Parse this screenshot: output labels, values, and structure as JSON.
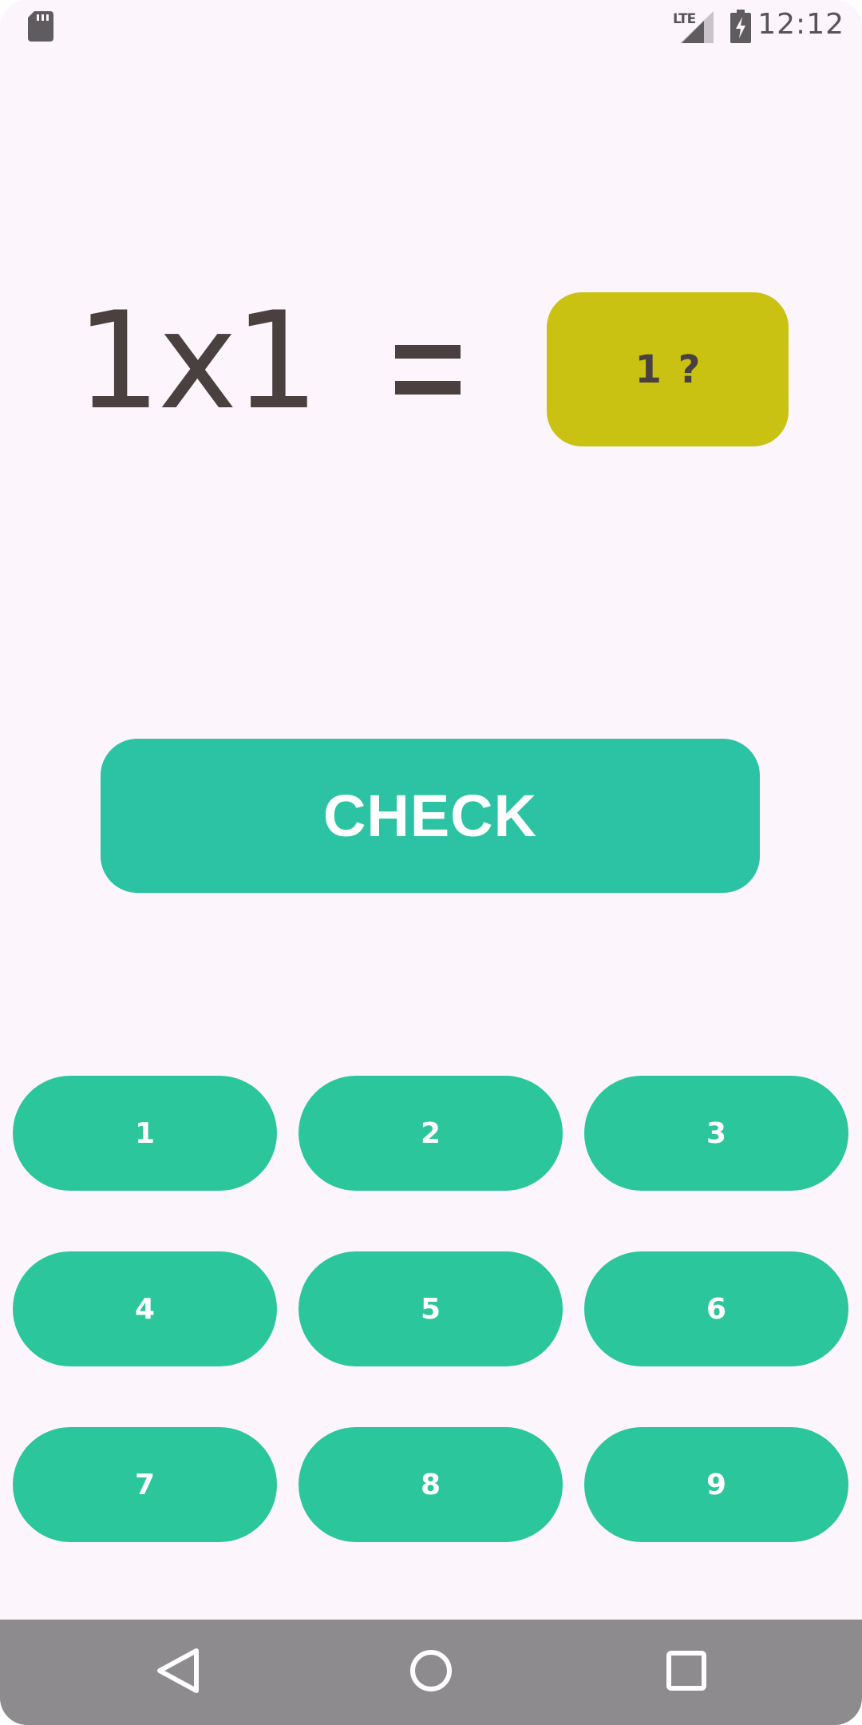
{
  "status_bar": {
    "time": "12:12",
    "network": "LTE",
    "icons": [
      "sd-card-icon",
      "signal-icon",
      "battery-charging-icon"
    ]
  },
  "equation": {
    "left_side": "1x1",
    "operator": "=",
    "answer": "1 ?"
  },
  "check_button": {
    "label": "CHECK"
  },
  "keypad": {
    "keys": [
      "1",
      "2",
      "3",
      "4",
      "5",
      "6",
      "7",
      "8",
      "9"
    ]
  },
  "nav_bar": {
    "icons": [
      "back-icon",
      "home-icon",
      "recents-icon"
    ]
  },
  "colors": {
    "background": "#fcf5fb",
    "text_dark": "#4a4040",
    "answer_box": "#c9c213",
    "check_button": "#2bc3a4",
    "keypad_key": "#2bc69b",
    "nav_bar": "#8d8b8e"
  }
}
